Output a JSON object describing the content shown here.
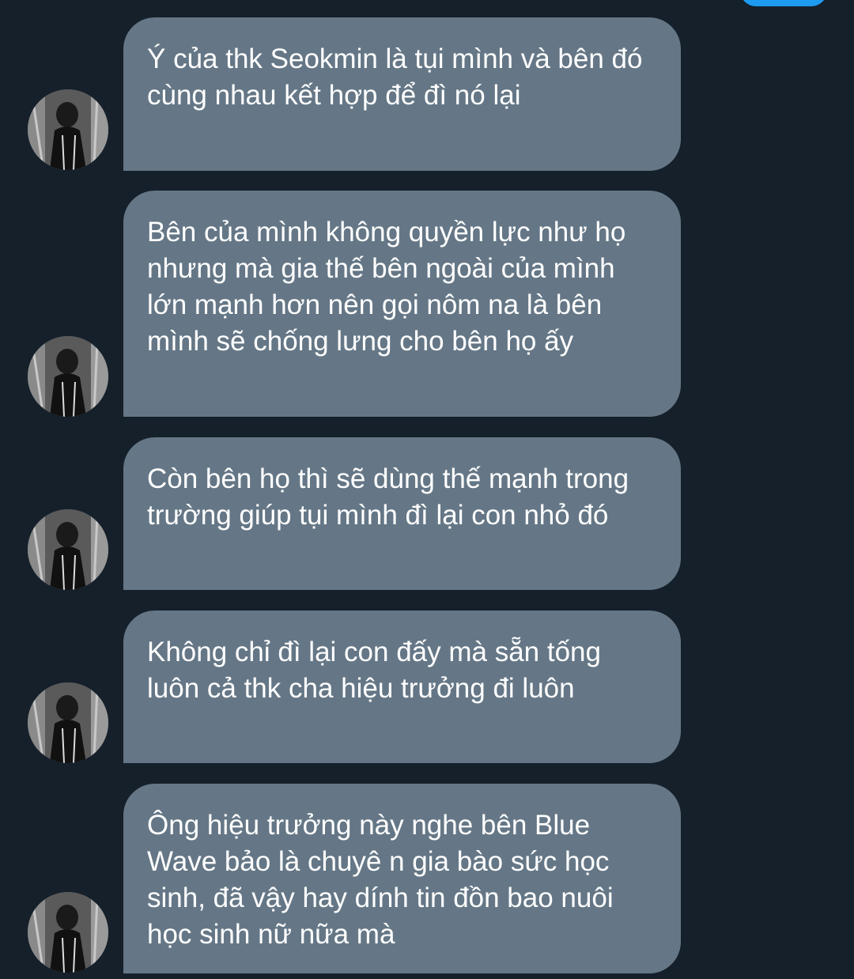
{
  "conversation": {
    "messages": [
      {
        "text": "Ý của thk Seokmin là tụi mình và bên đó cùng nhau kết hợp để đì nó lại"
      },
      {
        "text": "Bên của mình không quyền lực như họ nhưng mà gia thế bên ngoài của mình lớn mạnh hơn nên gọi nôm na là bên mình sẽ chống lưng cho bên họ ấy"
      },
      {
        "text": "Còn bên họ thì sẽ dùng thế mạnh trong trường giúp tụi mình đì lại con nhỏ đó"
      },
      {
        "text": "Không chỉ đì lại con đấy mà sẵn tống luôn cả thk cha hiệu trưởng đi luôn"
      },
      {
        "text": "Ông hiệu trưởng này nghe bên Blue Wave bảo là chuyê n gia bào sức học sinh, đã vậy hay dính tin đồn bao nuôi học sinh nữ nữa mà"
      }
    ]
  },
  "avatar_icon": "user-avatar-photo",
  "colors": {
    "background": "#15202b",
    "bubble": "#657786",
    "text": "#ffffff",
    "accent": "#1d9bf0"
  }
}
